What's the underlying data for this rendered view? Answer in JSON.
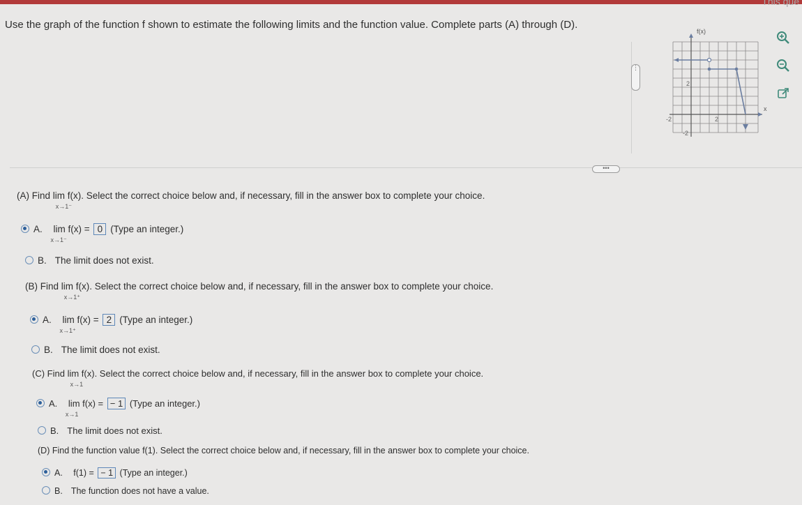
{
  "top_corner_text": "This que",
  "prompt": "Use the graph of the function f shown to estimate the following limits and the function value. Complete parts (A) through (D).",
  "graph": {
    "y_label": "f(x)",
    "x_label": "x",
    "tick_labels": {
      "x_neg": "-2",
      "x_pos": "2",
      "y_pos": "2",
      "y_neg": "-2"
    }
  },
  "tools": [
    "zoom-in-icon",
    "zoom-out-icon",
    "open-new-window-icon"
  ],
  "handles": {
    "vertical": "⋮",
    "horizontal": "•••"
  },
  "parts": [
    {
      "question_pre": "(A) Find",
      "lim_word": "lim",
      "lim_expr": " f(x).",
      "lim_sub": "x→1⁻",
      "question_post": " Select the correct choice below and, if necessary, fill in the answer box to complete your choice.",
      "option_a_label": "A.",
      "option_a_lhs": "lim f(x) =",
      "option_a_sub": "x→1⁻",
      "option_a_value": "0",
      "option_a_hint": "(Type an integer.)",
      "option_b_label": "B.",
      "option_b_text": "The limit does not exist.",
      "selected": "A"
    },
    {
      "question_pre": "(B) Find",
      "lim_word": "lim",
      "lim_expr": " f(x).",
      "lim_sub": "x→1⁺",
      "question_post": " Select the correct choice below and, if necessary, fill in the answer box to complete your choice.",
      "option_a_label": "A.",
      "option_a_lhs": "lim f(x) =",
      "option_a_sub": "x→1⁺",
      "option_a_value": "2",
      "option_a_hint": "(Type an integer.)",
      "option_b_label": "B.",
      "option_b_text": "The limit does not exist.",
      "selected": "A"
    },
    {
      "question_pre": "(C) Find",
      "lim_word": "lim",
      "lim_expr": " f(x).",
      "lim_sub": "x→1",
      "question_post": " Select the correct choice below and, if necessary, fill in the answer box to complete your choice.",
      "option_a_label": "A.",
      "option_a_lhs": "lim f(x) =",
      "option_a_sub": "x→1",
      "option_a_value": "− 1",
      "option_a_hint": "(Type an integer.)",
      "option_b_label": "B.",
      "option_b_text": "The limit does not exist.",
      "selected": "A"
    },
    {
      "question_pre": "(D) Find the function value f(1).",
      "question_post": " Select the correct choice below and, if necessary, fill in the answer box to complete your choice.",
      "option_a_label": "A.",
      "option_a_lhs": "f(1) =",
      "option_a_value": "− 1",
      "option_a_hint": "(Type an integer.)",
      "option_b_label": "B.",
      "option_b_text": "The function does not have a value.",
      "selected": "A"
    }
  ]
}
